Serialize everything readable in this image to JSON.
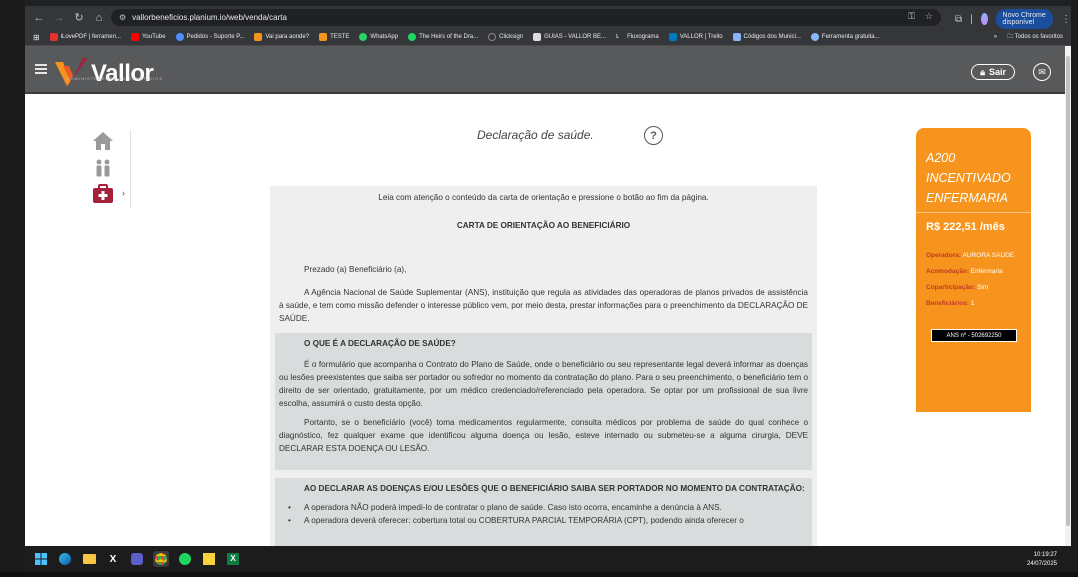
{
  "browser": {
    "url": "vallorbeneficios.planium.io/web/venda/carta",
    "update_label": "Novo Chrome disponível",
    "bookmarks": [
      {
        "label": "iLovePDF | ferramen...",
        "color": "#e5322d"
      },
      {
        "label": "YouTube",
        "color": "#ff0000"
      },
      {
        "label": "Pedidos - Suporte P...",
        "color": "#4f8cff"
      },
      {
        "label": "Vai para aonde?",
        "color": "#f7941d"
      },
      {
        "label": "TESTE",
        "color": "#f7941d"
      },
      {
        "label": "WhatsApp",
        "color": "#25d366"
      },
      {
        "label": "The Heirs of the Dra...",
        "color": "#1ed760"
      },
      {
        "label": "Clicksign",
        "color": "#333333"
      },
      {
        "label": "GUIAS - VALLOR BE...",
        "color": "#dddddd"
      },
      {
        "label": "Fluxograma",
        "color": "#ffffff"
      },
      {
        "label": "VALLOR | Trello",
        "color": "#0079bf"
      },
      {
        "label": "Códigos dos Munici...",
        "color": "#8ab4f8"
      },
      {
        "label": "Ferramenta gratuita...",
        "color": "#8ab4f8"
      }
    ],
    "all_favorites": "Todos os favoritos"
  },
  "header": {
    "brand": "Vallor",
    "brand_sub": "ADMINISTRADORA DE BENEFÍCIOS",
    "logout_label": "Sair"
  },
  "page": {
    "title": "Declaração de saúde.",
    "help_label": "?"
  },
  "letter": {
    "intro": "Leia com atenção o conteúdo da carta de orientação e pressione o botão ao fim da página.",
    "title": "CARTA DE ORIENTAÇÃO AO BENEFICIÁRIO",
    "greeting": "Prezado (a) Beneficiário (a),",
    "p1": "A Agência Nacional de Saúde Suplementar (ANS), instituição que regula as atividades das operadoras de planos privados de assistência à saúde, e tem como missão defender o interesse público vem, por meio desta, prestar informações para o preenchimento da DECLARAÇÃO DE SAÚDE.",
    "s1_heading": "O QUE É A DECLARAÇÃO DE SAÚDE?",
    "s1_p1": "É o formulário que acompanha o Contrato do Plano de Saúde, onde o beneficiário ou seu representante legal deverá informar as doenças ou lesões preexistentes que saiba ser portador ou sofredor no momento da contratação do plano. Para o seu preenchimento, o beneficiário tem o direito de ser orientado, gratuitamente, por um médico credenciado/referenciado pela operadora. Se optar por um profissional de sua livre escolha, assumirá o custo desta opção.",
    "s1_p2": "Portanto, se o beneficiário (você) toma medicamentos regularmente, consulta médicos por problema de saúde do qual conhece o diagnóstico, fez qualquer exame que identificou alguma doença ou lesão, esteve internado ou submeteu-se a alguma cirurgia, DEVE DECLARAR ESTA DOENÇA OU LESÃO.",
    "s2_heading": "AO DECLARAR AS DOENÇAS E/OU LESÕES QUE O BENEFICIÁRIO SAIBA SER PORTADOR NO MOMENTO DA CONTRATAÇÃO:",
    "s2_bullets": [
      "A operadora NÃO poderá impedi-lo de contratar o plano de saúde. Caso isto ocorra, encaminhe a denúncia à ANS.",
      "A operadora deverá oferecer: cobertura total ou COBERTURA PARCIAL TEMPORÁRIA (CPT), podendo ainda oferecer o"
    ]
  },
  "plan": {
    "name": "A200 INCENTIVADO ENFERMARIA",
    "price": "R$ 222,51 /mês",
    "operadora_label": "Operadora:",
    "operadora": "AURORA SAUDE",
    "acomodacao_label": "Acomodação:",
    "acomodacao": "Enfermaria",
    "coparticipacao_label": "Coparticipação:",
    "coparticipacao": "Sim",
    "beneficiarios_label": "Beneficiários:",
    "beneficiarios": "1",
    "ans": "ANS nº - 502692250"
  },
  "taskbar": {
    "time": "10:19:27",
    "date": "24/07/2025"
  },
  "colors": {
    "accent": "#f7941d",
    "brand_red": "#a3213a",
    "header_bg": "#58595b"
  }
}
